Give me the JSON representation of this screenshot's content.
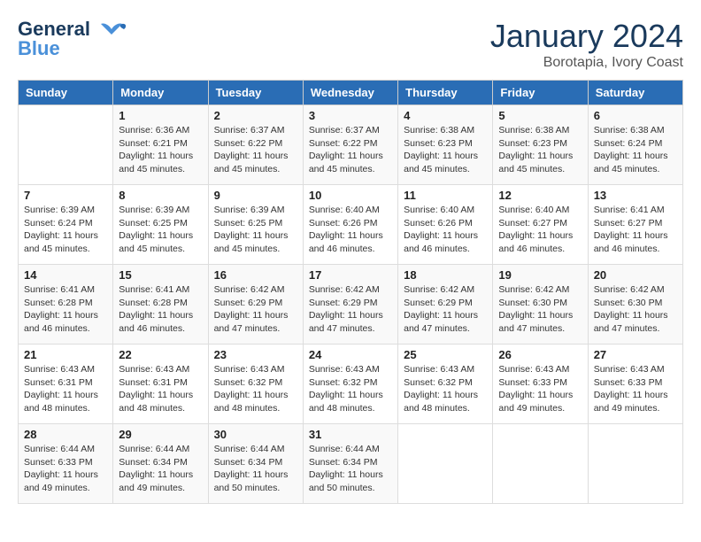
{
  "logo": {
    "line1": "General",
    "line2": "Blue"
  },
  "title": {
    "month_year": "January 2024",
    "location": "Borotapia, Ivory Coast"
  },
  "days_of_week": [
    "Sunday",
    "Monday",
    "Tuesday",
    "Wednesday",
    "Thursday",
    "Friday",
    "Saturday"
  ],
  "weeks": [
    [
      {
        "date": "",
        "sunrise": "",
        "sunset": "",
        "daylight": ""
      },
      {
        "date": "1",
        "sunrise": "Sunrise: 6:36 AM",
        "sunset": "Sunset: 6:21 PM",
        "daylight": "Daylight: 11 hours and 45 minutes."
      },
      {
        "date": "2",
        "sunrise": "Sunrise: 6:37 AM",
        "sunset": "Sunset: 6:22 PM",
        "daylight": "Daylight: 11 hours and 45 minutes."
      },
      {
        "date": "3",
        "sunrise": "Sunrise: 6:37 AM",
        "sunset": "Sunset: 6:22 PM",
        "daylight": "Daylight: 11 hours and 45 minutes."
      },
      {
        "date": "4",
        "sunrise": "Sunrise: 6:38 AM",
        "sunset": "Sunset: 6:23 PM",
        "daylight": "Daylight: 11 hours and 45 minutes."
      },
      {
        "date": "5",
        "sunrise": "Sunrise: 6:38 AM",
        "sunset": "Sunset: 6:23 PM",
        "daylight": "Daylight: 11 hours and 45 minutes."
      },
      {
        "date": "6",
        "sunrise": "Sunrise: 6:38 AM",
        "sunset": "Sunset: 6:24 PM",
        "daylight": "Daylight: 11 hours and 45 minutes."
      }
    ],
    [
      {
        "date": "7",
        "sunrise": "Sunrise: 6:39 AM",
        "sunset": "Sunset: 6:24 PM",
        "daylight": "Daylight: 11 hours and 45 minutes."
      },
      {
        "date": "8",
        "sunrise": "Sunrise: 6:39 AM",
        "sunset": "Sunset: 6:25 PM",
        "daylight": "Daylight: 11 hours and 45 minutes."
      },
      {
        "date": "9",
        "sunrise": "Sunrise: 6:39 AM",
        "sunset": "Sunset: 6:25 PM",
        "daylight": "Daylight: 11 hours and 45 minutes."
      },
      {
        "date": "10",
        "sunrise": "Sunrise: 6:40 AM",
        "sunset": "Sunset: 6:26 PM",
        "daylight": "Daylight: 11 hours and 46 minutes."
      },
      {
        "date": "11",
        "sunrise": "Sunrise: 6:40 AM",
        "sunset": "Sunset: 6:26 PM",
        "daylight": "Daylight: 11 hours and 46 minutes."
      },
      {
        "date": "12",
        "sunrise": "Sunrise: 6:40 AM",
        "sunset": "Sunset: 6:27 PM",
        "daylight": "Daylight: 11 hours and 46 minutes."
      },
      {
        "date": "13",
        "sunrise": "Sunrise: 6:41 AM",
        "sunset": "Sunset: 6:27 PM",
        "daylight": "Daylight: 11 hours and 46 minutes."
      }
    ],
    [
      {
        "date": "14",
        "sunrise": "Sunrise: 6:41 AM",
        "sunset": "Sunset: 6:28 PM",
        "daylight": "Daylight: 11 hours and 46 minutes."
      },
      {
        "date": "15",
        "sunrise": "Sunrise: 6:41 AM",
        "sunset": "Sunset: 6:28 PM",
        "daylight": "Daylight: 11 hours and 46 minutes."
      },
      {
        "date": "16",
        "sunrise": "Sunrise: 6:42 AM",
        "sunset": "Sunset: 6:29 PM",
        "daylight": "Daylight: 11 hours and 47 minutes."
      },
      {
        "date": "17",
        "sunrise": "Sunrise: 6:42 AM",
        "sunset": "Sunset: 6:29 PM",
        "daylight": "Daylight: 11 hours and 47 minutes."
      },
      {
        "date": "18",
        "sunrise": "Sunrise: 6:42 AM",
        "sunset": "Sunset: 6:29 PM",
        "daylight": "Daylight: 11 hours and 47 minutes."
      },
      {
        "date": "19",
        "sunrise": "Sunrise: 6:42 AM",
        "sunset": "Sunset: 6:30 PM",
        "daylight": "Daylight: 11 hours and 47 minutes."
      },
      {
        "date": "20",
        "sunrise": "Sunrise: 6:42 AM",
        "sunset": "Sunset: 6:30 PM",
        "daylight": "Daylight: 11 hours and 47 minutes."
      }
    ],
    [
      {
        "date": "21",
        "sunrise": "Sunrise: 6:43 AM",
        "sunset": "Sunset: 6:31 PM",
        "daylight": "Daylight: 11 hours and 48 minutes."
      },
      {
        "date": "22",
        "sunrise": "Sunrise: 6:43 AM",
        "sunset": "Sunset: 6:31 PM",
        "daylight": "Daylight: 11 hours and 48 minutes."
      },
      {
        "date": "23",
        "sunrise": "Sunrise: 6:43 AM",
        "sunset": "Sunset: 6:32 PM",
        "daylight": "Daylight: 11 hours and 48 minutes."
      },
      {
        "date": "24",
        "sunrise": "Sunrise: 6:43 AM",
        "sunset": "Sunset: 6:32 PM",
        "daylight": "Daylight: 11 hours and 48 minutes."
      },
      {
        "date": "25",
        "sunrise": "Sunrise: 6:43 AM",
        "sunset": "Sunset: 6:32 PM",
        "daylight": "Daylight: 11 hours and 48 minutes."
      },
      {
        "date": "26",
        "sunrise": "Sunrise: 6:43 AM",
        "sunset": "Sunset: 6:33 PM",
        "daylight": "Daylight: 11 hours and 49 minutes."
      },
      {
        "date": "27",
        "sunrise": "Sunrise: 6:43 AM",
        "sunset": "Sunset: 6:33 PM",
        "daylight": "Daylight: 11 hours and 49 minutes."
      }
    ],
    [
      {
        "date": "28",
        "sunrise": "Sunrise: 6:44 AM",
        "sunset": "Sunset: 6:33 PM",
        "daylight": "Daylight: 11 hours and 49 minutes."
      },
      {
        "date": "29",
        "sunrise": "Sunrise: 6:44 AM",
        "sunset": "Sunset: 6:34 PM",
        "daylight": "Daylight: 11 hours and 49 minutes."
      },
      {
        "date": "30",
        "sunrise": "Sunrise: 6:44 AM",
        "sunset": "Sunset: 6:34 PM",
        "daylight": "Daylight: 11 hours and 50 minutes."
      },
      {
        "date": "31",
        "sunrise": "Sunrise: 6:44 AM",
        "sunset": "Sunset: 6:34 PM",
        "daylight": "Daylight: 11 hours and 50 minutes."
      },
      {
        "date": "",
        "sunrise": "",
        "sunset": "",
        "daylight": ""
      },
      {
        "date": "",
        "sunrise": "",
        "sunset": "",
        "daylight": ""
      },
      {
        "date": "",
        "sunrise": "",
        "sunset": "",
        "daylight": ""
      }
    ]
  ]
}
